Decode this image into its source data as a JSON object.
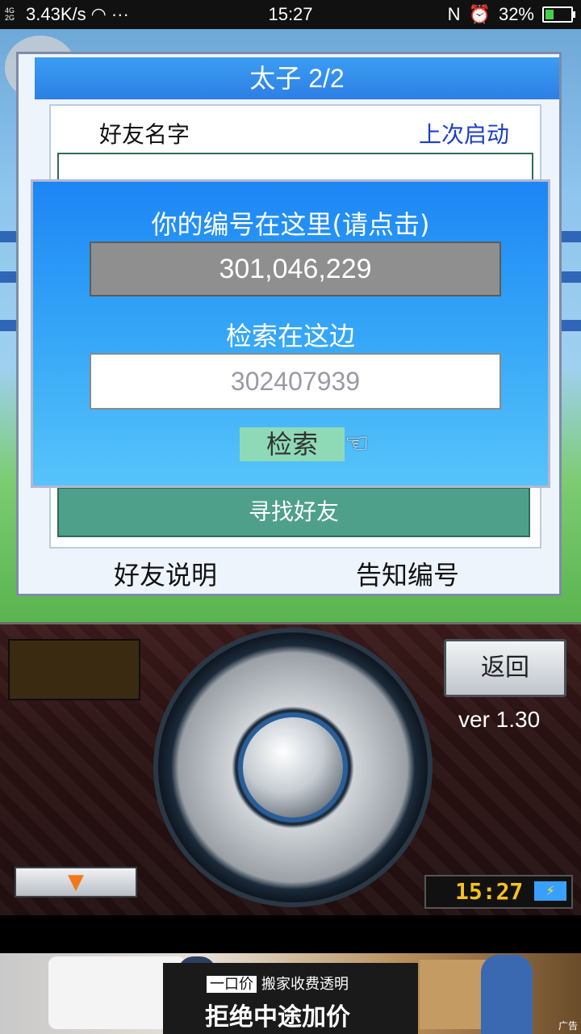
{
  "status_bar": {
    "network": "4G 2G",
    "speed": "3.43K/s",
    "dots": "···",
    "time": "15:27",
    "battery": "32%"
  },
  "panel": {
    "title": "太子 2/2",
    "friend_name_header": "好友名字",
    "last_launch_header": "上次启动",
    "find_friend_button": "寻找好友",
    "friend_help": "好友说明",
    "notify_id": "告知编号"
  },
  "dialog": {
    "title": "你的编号在这里(请点击)",
    "your_id": "301,046,229",
    "search_label": "检索在这边",
    "search_value": "302407939",
    "search_button": "检索",
    "pointer_icon": "☜"
  },
  "controller": {
    "back_button": "返回",
    "version": "ver 1.30",
    "down_arrow": "▼",
    "clock": "15:27",
    "battery_icon": "⚡"
  },
  "ad": {
    "tag_pill": "一口价",
    "tag_text": "搬家收费透明",
    "headline": "拒绝中途加价",
    "label": "广告"
  },
  "colors": {
    "title_blue": "#2d7fe4",
    "dialog_blue": "#1c86f4",
    "find_button": "#4fa08a",
    "search_button": "#8fdab6",
    "link_blue": "#1b3fc9"
  }
}
